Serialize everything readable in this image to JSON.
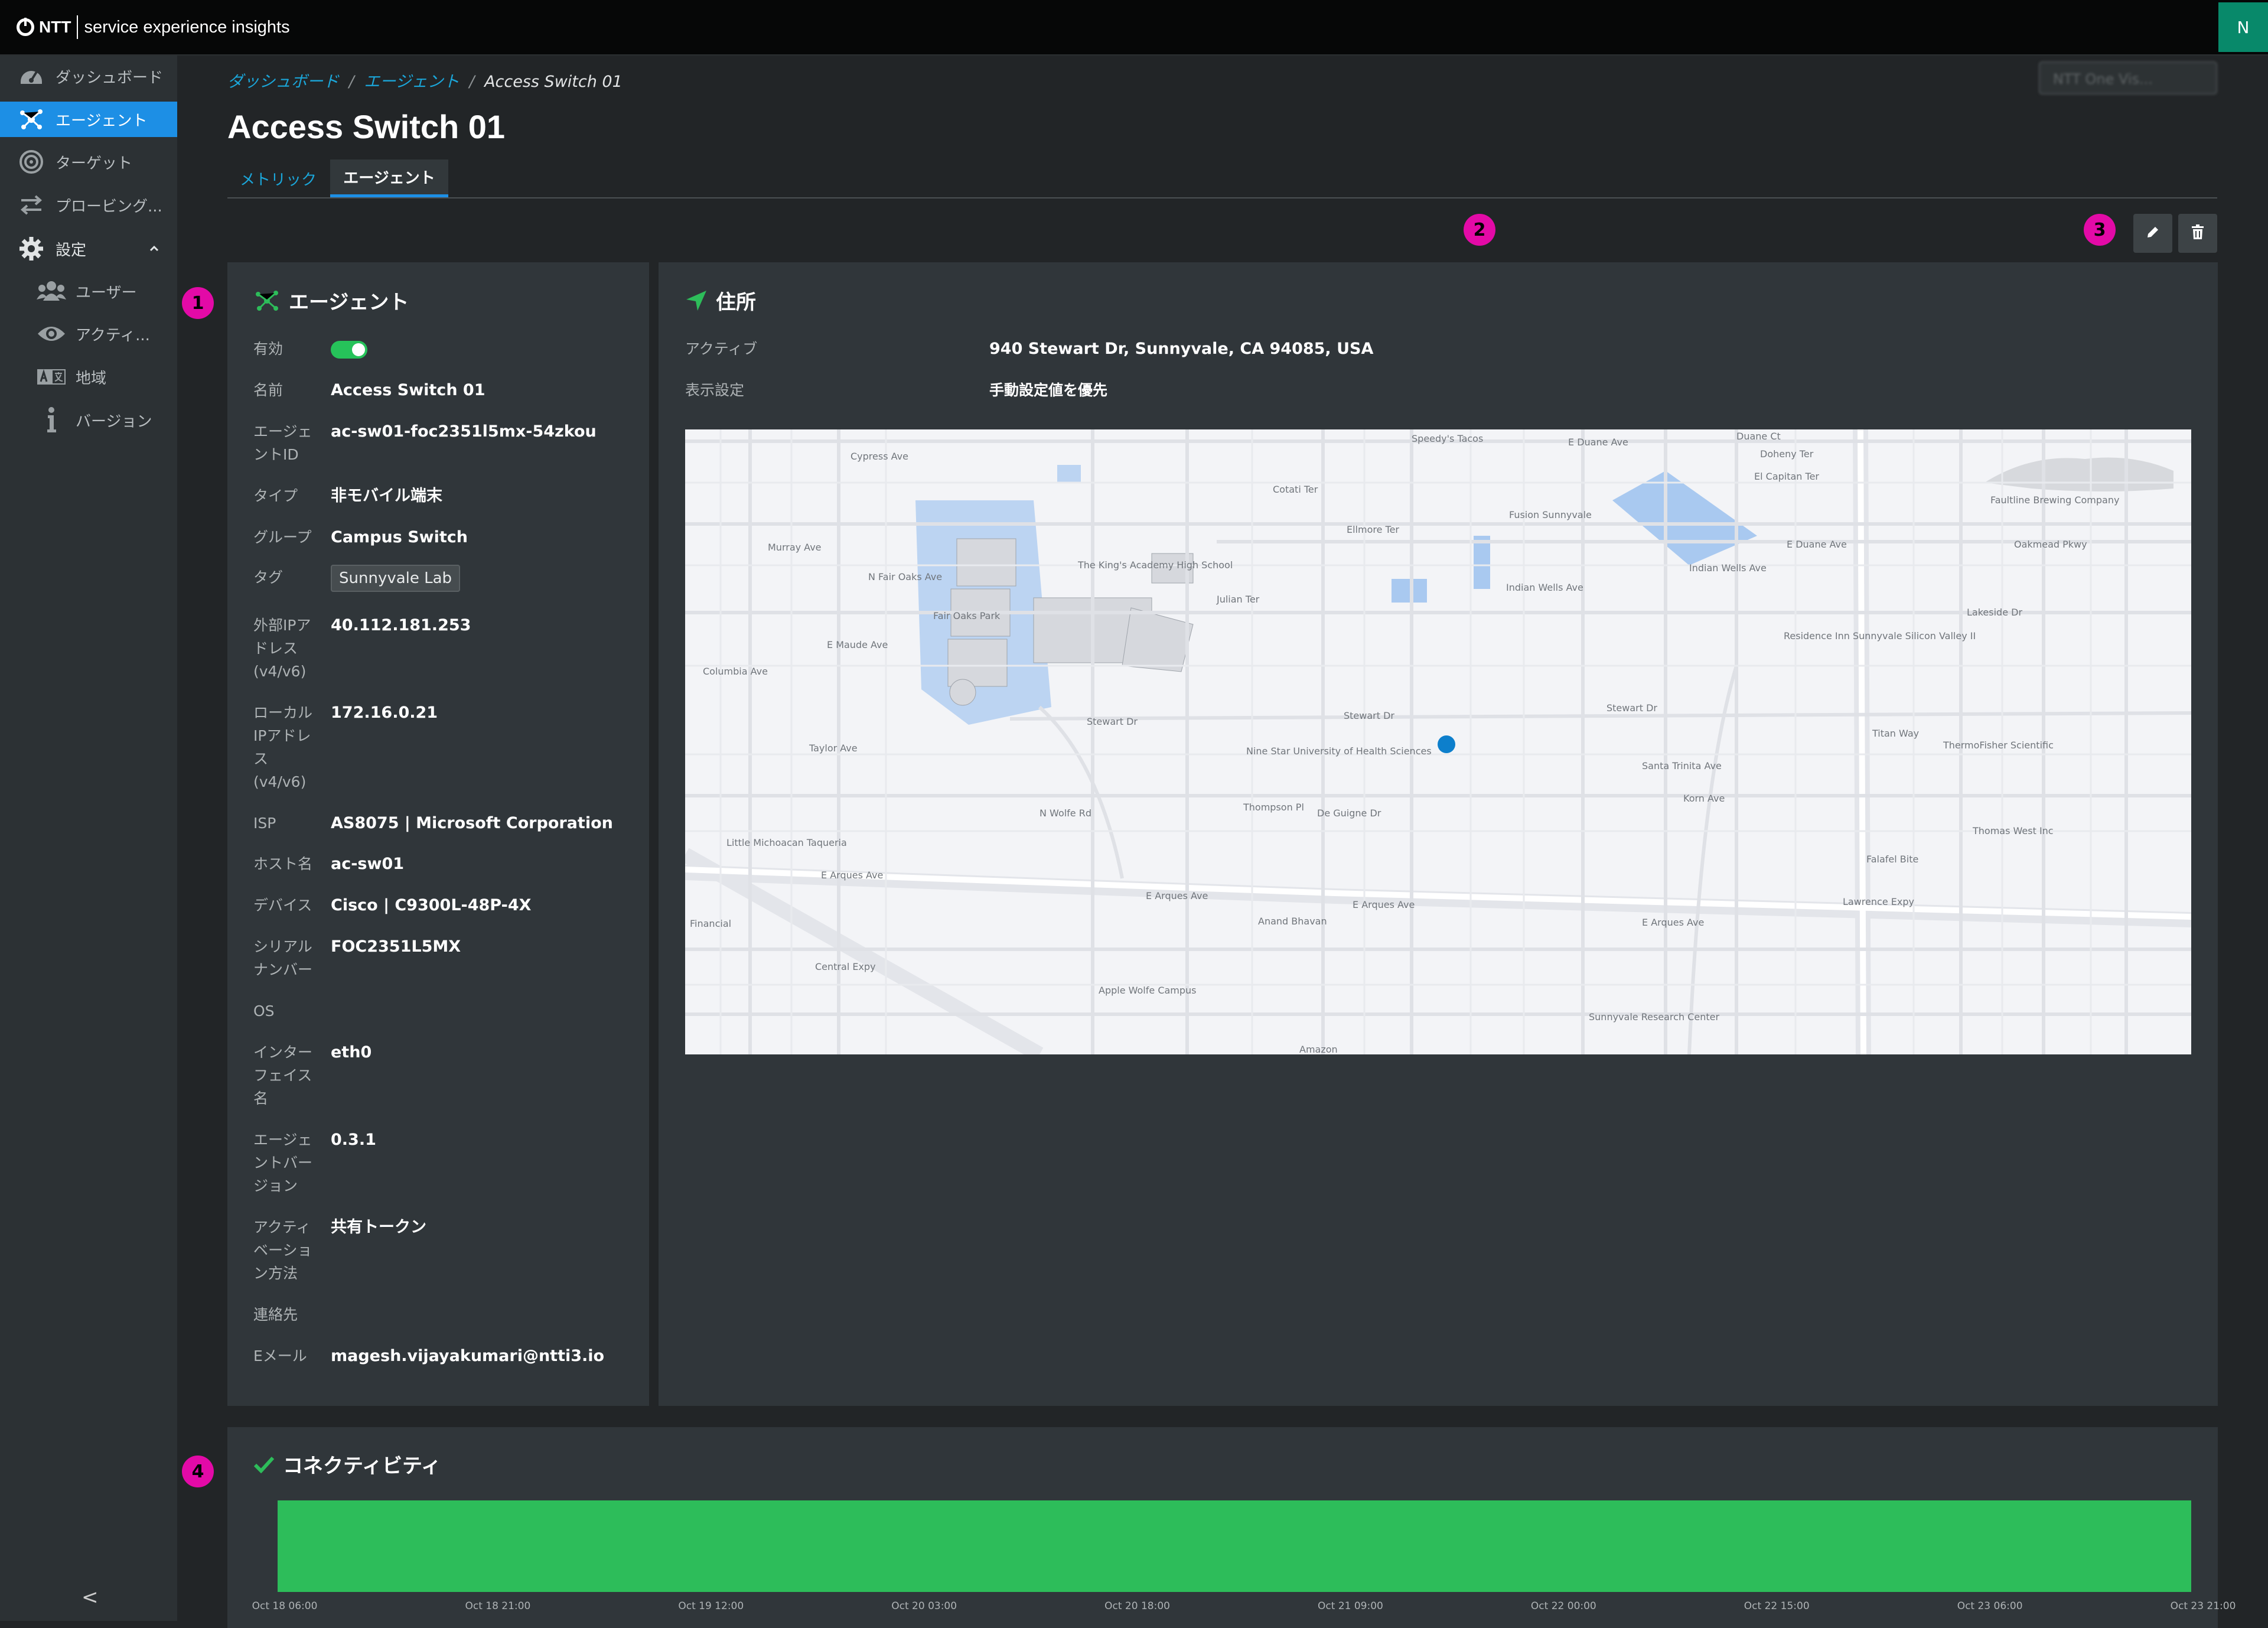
{
  "header": {
    "brand": "NTT",
    "product": "service experience insights",
    "user_initial": "N"
  },
  "sidebar": {
    "items": [
      {
        "label": "ダッシュボード",
        "icon": "gauge-icon"
      },
      {
        "label": "エージェント",
        "icon": "agent-network-icon",
        "active": true
      },
      {
        "label": "ターゲット",
        "icon": "target-icon"
      },
      {
        "label": "プロービング...",
        "icon": "arrows-exchange-icon"
      },
      {
        "label": "設定",
        "icon": "gear-icon",
        "expanded": true
      },
      {
        "label": "ユーザー",
        "icon": "users-icon"
      },
      {
        "label": "アクティ...",
        "icon": "eye-icon"
      },
      {
        "label": "地域",
        "icon": "translate-icon"
      },
      {
        "label": "バージョン",
        "icon": "info-icon"
      }
    ],
    "collapse_glyph": "<"
  },
  "breadcrumb": {
    "items": [
      "ダッシュボード",
      "エージェント"
    ],
    "current": "Access Switch 01",
    "separator": "/"
  },
  "search_placeholder": "NTT One Vis...",
  "page_title": "Access Switch 01",
  "tabs": [
    {
      "label": "メトリック",
      "active": false
    },
    {
      "label": "エージェント",
      "active": true
    }
  ],
  "markers": [
    "1",
    "2",
    "3",
    "4"
  ],
  "agent_panel": {
    "title": "エージェント",
    "fields": {
      "enabled_label": "有効",
      "enabled": true,
      "name_label": "名前",
      "name": "Access Switch 01",
      "agent_id_label": "エージェントID",
      "agent_id": "ac-sw01-foc2351l5mx-54zkou",
      "type_label": "タイプ",
      "type": "非モバイル端末",
      "group_label": "グループ",
      "group": "Campus Switch",
      "tag_label": "タグ",
      "tag": "Sunnyvale Lab",
      "ext_ip_label": "外部IPアドレス (v4/v6)",
      "ext_ip": "40.112.181.253",
      "local_ip_label": "ローカルIPアドレス (v4/v6)",
      "local_ip": "172.16.0.21",
      "isp_label": "ISP",
      "isp": "AS8075 | Microsoft Corporation",
      "hostname_label": "ホスト名",
      "hostname": "ac-sw01",
      "device_label": "デバイス",
      "device": "Cisco | C9300L-48P-4X",
      "serial_label": "シリアルナンバー",
      "serial": "FOC2351L5MX",
      "os_label": "OS",
      "os": "",
      "interface_label": "インターフェイス名",
      "interface": "eth0",
      "agent_version_label": "エージェントバージョン",
      "agent_version": "0.3.1",
      "activation_label": "アクティベーション方法",
      "activation": "共有トークン",
      "contact_label": "連絡先",
      "contact": "",
      "email_label": "Eメール",
      "email": "magesh.vijayakumari@ntti3.io"
    }
  },
  "address_panel": {
    "title": "住所",
    "active_label": "アクティブ",
    "active_value": "940 Stewart Dr, Sunnyvale, CA 94085, USA",
    "display_label": "表示設定",
    "display_value": "手動設定値を優先"
  },
  "map": {
    "labels": [
      "Speedy's Tacos",
      "E Duane Ave",
      "Duane Ct",
      "Doheny Ter",
      "El Capitan Ter",
      "Cypress Ave",
      "Cotati Ter",
      "Fusion Sunnyvale",
      "Faultline Brewing Company",
      "Oakmead Pkwy",
      "E Duane Ave",
      "Indian Wells Ave",
      "Indian Wells Ave",
      "The King's Academy High School",
      "Julian Ter",
      "Fair Oaks Park",
      "N Fair Oaks Ave",
      "Murray Ave",
      "E Maude Ave",
      "Columbia Ave",
      "Residence Inn Sunnyvale Silicon Valley II",
      "Stewart Dr",
      "Stewart Dr",
      "Stewart Dr",
      "Nine Star University of Health Sciences",
      "Taylor Ave",
      "Lakeside Dr",
      "Titan Way",
      "ThermoFisher Scientific",
      "Thompson Pl",
      "De Guigne Dr",
      "Santa Trinita Ave",
      "Korn Ave",
      "Little Michoacan Taqueria",
      "Thomas West Inc",
      "E Arques Ave",
      "E Arques Ave",
      "E Arques Ave",
      "E Arques Ave",
      "Falafel Bite",
      "Lawrence Expy",
      "Anand Bhavan",
      "Financial",
      "Central Expy",
      "Apple Wolfe Campus",
      "Sunnyvale Research Center",
      "Amazon",
      "N Wolfe Rd",
      "Ellmore Ter"
    ]
  },
  "connectivity": {
    "title": "コネクティビティ",
    "bar_color": "#2dbd5a",
    "ticks": [
      "Oct 18 06:00",
      "Oct 18 21:00",
      "Oct 19 12:00",
      "Oct 20 03:00",
      "Oct 20 18:00",
      "Oct 21 09:00",
      "Oct 22 00:00",
      "Oct 22 15:00",
      "Oct 23 06:00",
      "Oct 23 21:00"
    ]
  },
  "colors": {
    "accent": "#1d8fe5",
    "link": "#1ba6d9",
    "success": "#2dbd5a",
    "marker": "#e30aa7"
  }
}
